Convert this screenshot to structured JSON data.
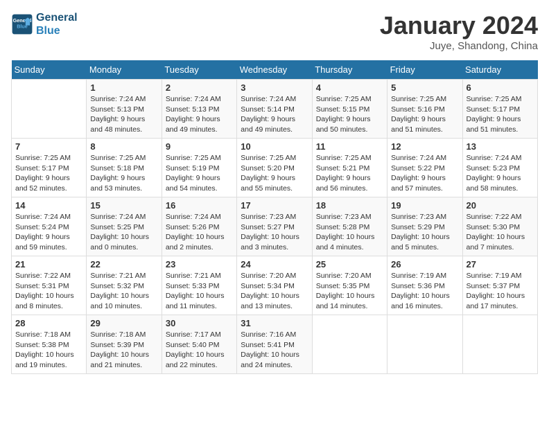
{
  "header": {
    "logo_line1": "General",
    "logo_line2": "Blue",
    "month": "January 2024",
    "location": "Juye, Shandong, China"
  },
  "days_of_week": [
    "Sunday",
    "Monday",
    "Tuesday",
    "Wednesday",
    "Thursday",
    "Friday",
    "Saturday"
  ],
  "weeks": [
    [
      {
        "day": "",
        "info": ""
      },
      {
        "day": "1",
        "info": "Sunrise: 7:24 AM\nSunset: 5:13 PM\nDaylight: 9 hours\nand 48 minutes."
      },
      {
        "day": "2",
        "info": "Sunrise: 7:24 AM\nSunset: 5:13 PM\nDaylight: 9 hours\nand 49 minutes."
      },
      {
        "day": "3",
        "info": "Sunrise: 7:24 AM\nSunset: 5:14 PM\nDaylight: 9 hours\nand 49 minutes."
      },
      {
        "day": "4",
        "info": "Sunrise: 7:25 AM\nSunset: 5:15 PM\nDaylight: 9 hours\nand 50 minutes."
      },
      {
        "day": "5",
        "info": "Sunrise: 7:25 AM\nSunset: 5:16 PM\nDaylight: 9 hours\nand 51 minutes."
      },
      {
        "day": "6",
        "info": "Sunrise: 7:25 AM\nSunset: 5:17 PM\nDaylight: 9 hours\nand 51 minutes."
      }
    ],
    [
      {
        "day": "7",
        "info": "Sunrise: 7:25 AM\nSunset: 5:17 PM\nDaylight: 9 hours\nand 52 minutes."
      },
      {
        "day": "8",
        "info": "Sunrise: 7:25 AM\nSunset: 5:18 PM\nDaylight: 9 hours\nand 53 minutes."
      },
      {
        "day": "9",
        "info": "Sunrise: 7:25 AM\nSunset: 5:19 PM\nDaylight: 9 hours\nand 54 minutes."
      },
      {
        "day": "10",
        "info": "Sunrise: 7:25 AM\nSunset: 5:20 PM\nDaylight: 9 hours\nand 55 minutes."
      },
      {
        "day": "11",
        "info": "Sunrise: 7:25 AM\nSunset: 5:21 PM\nDaylight: 9 hours\nand 56 minutes."
      },
      {
        "day": "12",
        "info": "Sunrise: 7:24 AM\nSunset: 5:22 PM\nDaylight: 9 hours\nand 57 minutes."
      },
      {
        "day": "13",
        "info": "Sunrise: 7:24 AM\nSunset: 5:23 PM\nDaylight: 9 hours\nand 58 minutes."
      }
    ],
    [
      {
        "day": "14",
        "info": "Sunrise: 7:24 AM\nSunset: 5:24 PM\nDaylight: 9 hours\nand 59 minutes."
      },
      {
        "day": "15",
        "info": "Sunrise: 7:24 AM\nSunset: 5:25 PM\nDaylight: 10 hours\nand 0 minutes."
      },
      {
        "day": "16",
        "info": "Sunrise: 7:24 AM\nSunset: 5:26 PM\nDaylight: 10 hours\nand 2 minutes."
      },
      {
        "day": "17",
        "info": "Sunrise: 7:23 AM\nSunset: 5:27 PM\nDaylight: 10 hours\nand 3 minutes."
      },
      {
        "day": "18",
        "info": "Sunrise: 7:23 AM\nSunset: 5:28 PM\nDaylight: 10 hours\nand 4 minutes."
      },
      {
        "day": "19",
        "info": "Sunrise: 7:23 AM\nSunset: 5:29 PM\nDaylight: 10 hours\nand 5 minutes."
      },
      {
        "day": "20",
        "info": "Sunrise: 7:22 AM\nSunset: 5:30 PM\nDaylight: 10 hours\nand 7 minutes."
      }
    ],
    [
      {
        "day": "21",
        "info": "Sunrise: 7:22 AM\nSunset: 5:31 PM\nDaylight: 10 hours\nand 8 minutes."
      },
      {
        "day": "22",
        "info": "Sunrise: 7:21 AM\nSunset: 5:32 PM\nDaylight: 10 hours\nand 10 minutes."
      },
      {
        "day": "23",
        "info": "Sunrise: 7:21 AM\nSunset: 5:33 PM\nDaylight: 10 hours\nand 11 minutes."
      },
      {
        "day": "24",
        "info": "Sunrise: 7:20 AM\nSunset: 5:34 PM\nDaylight: 10 hours\nand 13 minutes."
      },
      {
        "day": "25",
        "info": "Sunrise: 7:20 AM\nSunset: 5:35 PM\nDaylight: 10 hours\nand 14 minutes."
      },
      {
        "day": "26",
        "info": "Sunrise: 7:19 AM\nSunset: 5:36 PM\nDaylight: 10 hours\nand 16 minutes."
      },
      {
        "day": "27",
        "info": "Sunrise: 7:19 AM\nSunset: 5:37 PM\nDaylight: 10 hours\nand 17 minutes."
      }
    ],
    [
      {
        "day": "28",
        "info": "Sunrise: 7:18 AM\nSunset: 5:38 PM\nDaylight: 10 hours\nand 19 minutes."
      },
      {
        "day": "29",
        "info": "Sunrise: 7:18 AM\nSunset: 5:39 PM\nDaylight: 10 hours\nand 21 minutes."
      },
      {
        "day": "30",
        "info": "Sunrise: 7:17 AM\nSunset: 5:40 PM\nDaylight: 10 hours\nand 22 minutes."
      },
      {
        "day": "31",
        "info": "Sunrise: 7:16 AM\nSunset: 5:41 PM\nDaylight: 10 hours\nand 24 minutes."
      },
      {
        "day": "",
        "info": ""
      },
      {
        "day": "",
        "info": ""
      },
      {
        "day": "",
        "info": ""
      }
    ]
  ]
}
